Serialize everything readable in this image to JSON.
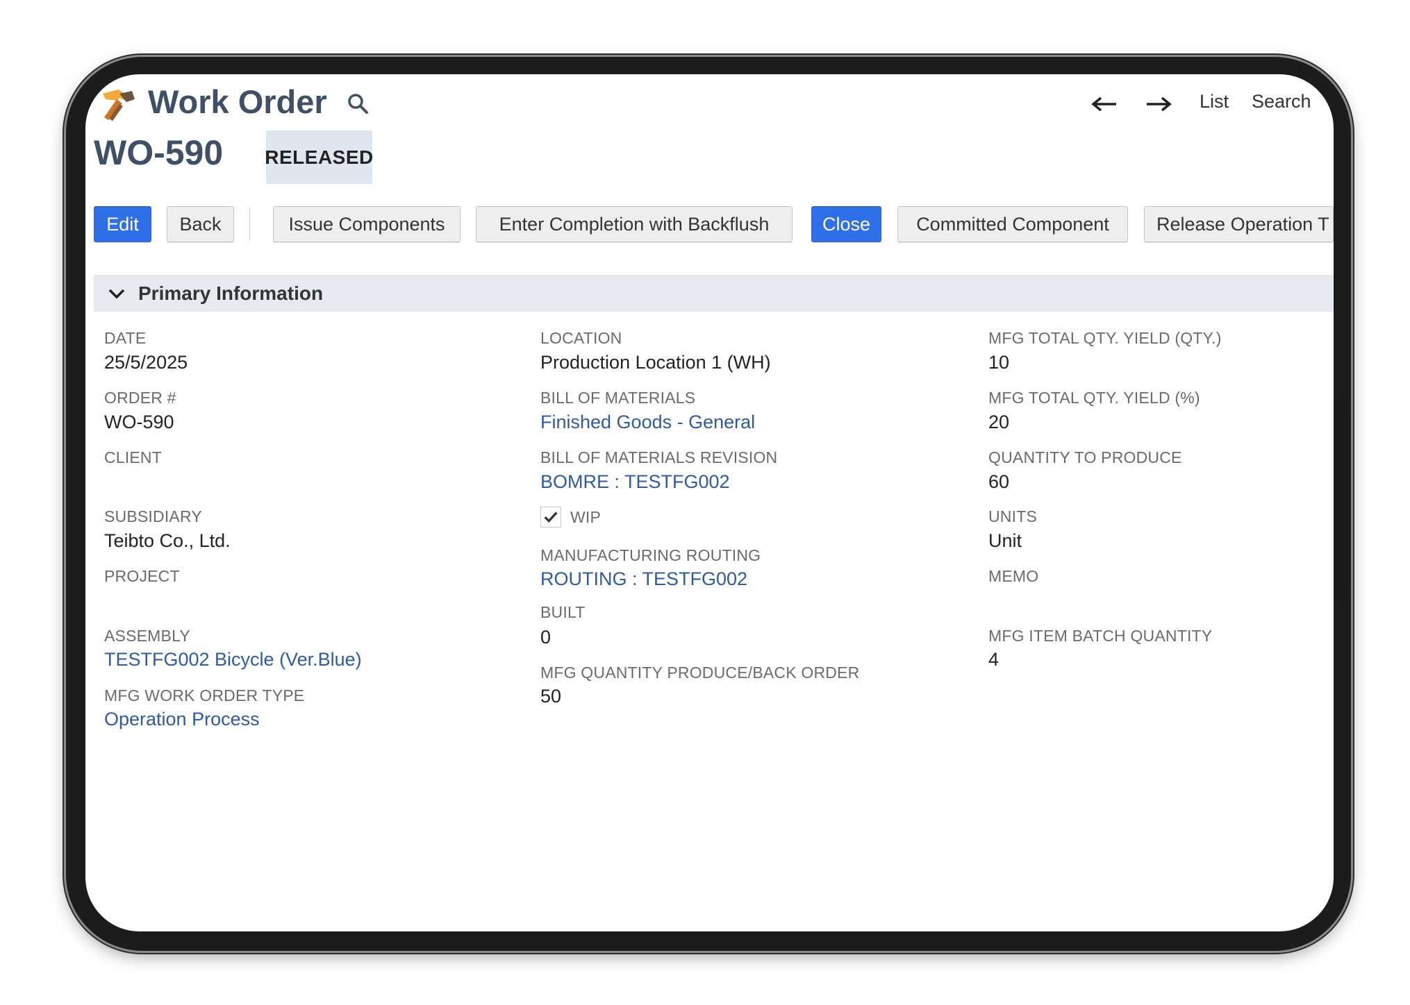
{
  "header": {
    "page_title": "Work Order",
    "app_icon": "hammer-icon",
    "search_icon": "search-icon",
    "nav": {
      "back_icon": "arrow-left-icon",
      "forward_icon": "arrow-right-icon",
      "list_label": "List",
      "search_label": "Search"
    }
  },
  "record": {
    "id": "WO-590",
    "status": "RELEASED"
  },
  "toolbar": {
    "edit": "Edit",
    "back": "Back",
    "issue_components": "Issue Components",
    "enter_completion": "Enter Completion with Backflush",
    "close": "Close",
    "committed_component": "Committed Component",
    "release_operation": "Release Operation T"
  },
  "section": {
    "title": "Primary Information",
    "icon": "chevron-down-icon"
  },
  "fields": {
    "date": {
      "label": "DATE",
      "value": "25/5/2025"
    },
    "order_no": {
      "label": "ORDER #",
      "value": "WO-590"
    },
    "client": {
      "label": "CLIENT",
      "value": ""
    },
    "subsidiary": {
      "label": "SUBSIDIARY",
      "value": "Teibto Co., Ltd."
    },
    "project": {
      "label": "PROJECT",
      "value": ""
    },
    "assembly": {
      "label": "ASSEMBLY",
      "value": "TESTFG002 Bicycle (Ver.Blue)"
    },
    "work_order_type": {
      "label": "MFG WORK ORDER TYPE",
      "value": "Operation Process"
    },
    "location": {
      "label": "LOCATION",
      "value": "Production Location 1 (WH)"
    },
    "bom": {
      "label": "BILL OF MATERIALS",
      "value": "Finished Goods - General"
    },
    "bom_revision": {
      "label": "BILL OF MATERIALS REVISION",
      "value": "BOMRE : TESTFG002"
    },
    "wip": {
      "label": "WIP",
      "checked": true
    },
    "routing": {
      "label": "MANUFACTURING ROUTING",
      "value": "ROUTING : TESTFG002"
    },
    "built": {
      "label": "BUILT",
      "value": "0"
    },
    "produce_back_order": {
      "label": "MFG QUANTITY PRODUCE/BACK ORDER",
      "value": "50"
    },
    "yield_qty": {
      "label": "MFG TOTAL QTY. YIELD (QTY.)",
      "value": "10"
    },
    "yield_pct": {
      "label": "MFG TOTAL QTY. YIELD (%)",
      "value": "20"
    },
    "qty_to_produce": {
      "label": "QUANTITY TO PRODUCE",
      "value": "60"
    },
    "units": {
      "label": "UNITS",
      "value": "Unit"
    },
    "memo": {
      "label": "MEMO",
      "value": ""
    },
    "batch_qty": {
      "label": "MFG ITEM BATCH QUANTITY",
      "value": "4"
    }
  },
  "colors": {
    "primary_button": "#2f6fe8",
    "link": "#2f5aa8",
    "title": "#3f4f66",
    "badge_bg": "#dfe6ef",
    "section_bg": "#e6e9ed"
  }
}
